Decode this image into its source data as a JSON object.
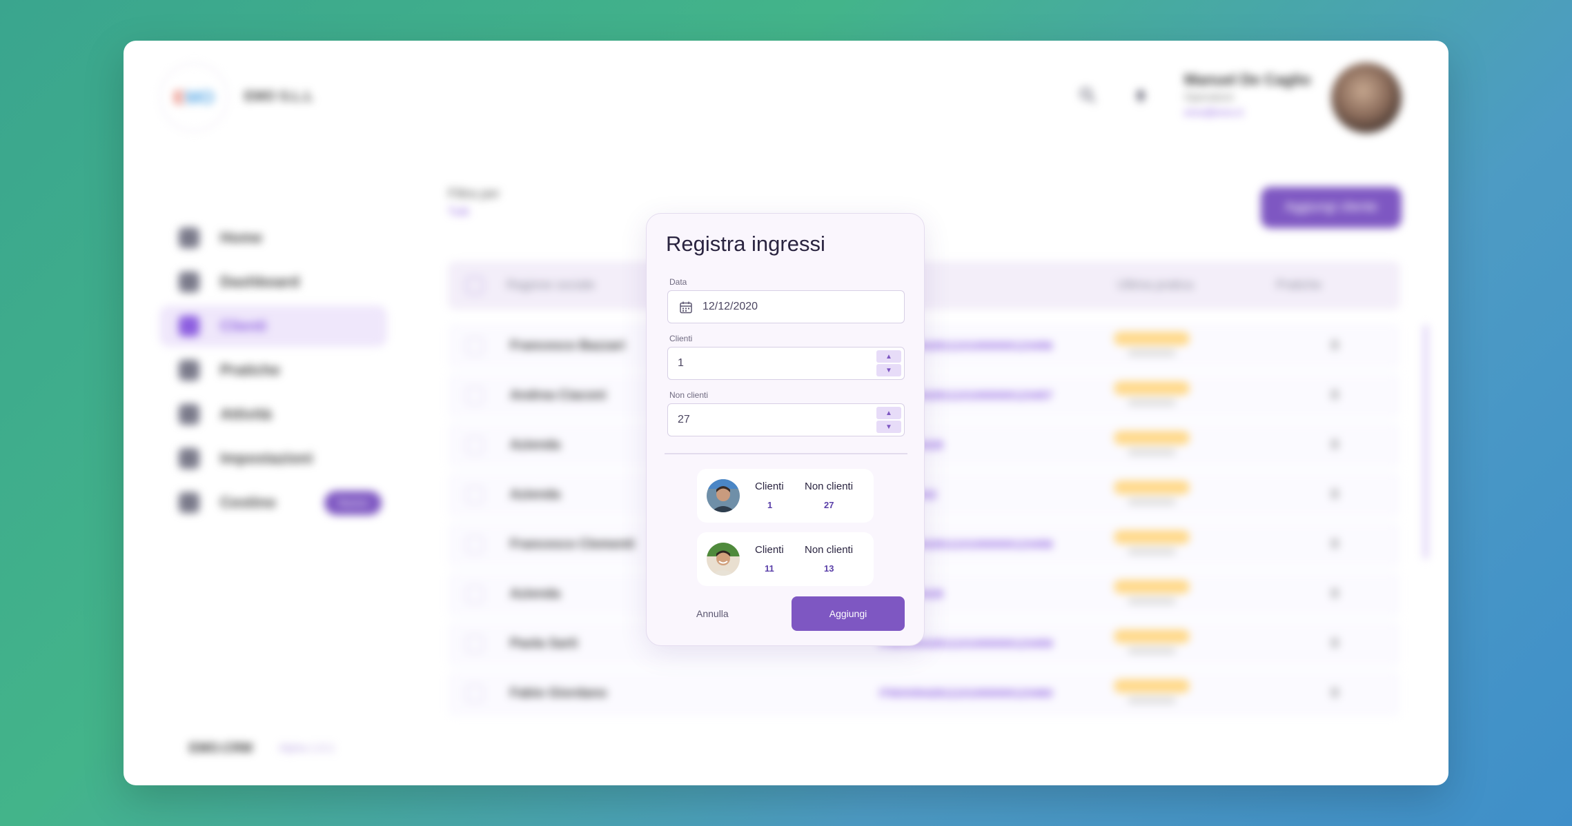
{
  "background_page": {
    "company_name": "EMO S.L.L",
    "user": {
      "name": "Manuel De Caglio",
      "role": "Operatore",
      "email": "emo@emo.it"
    },
    "sidebar": {
      "items": [
        {
          "label": "Home",
          "active": false
        },
        {
          "label": "Dashboard",
          "active": false
        },
        {
          "label": "Clienti",
          "active": true
        },
        {
          "label": "Pratiche",
          "active": false
        },
        {
          "label": "Attività",
          "active": false
        },
        {
          "label": "Impostazioni",
          "active": false
        },
        {
          "label": "Cestino",
          "active": false,
          "badge": "Nuovo"
        }
      ],
      "footer_brand": "EMO.CRM",
      "footer_version": "Alpha 1.0.1"
    },
    "filter": {
      "label": "Filtra per",
      "value": "Tutti"
    },
    "add_client_label": "Aggiungi cliente",
    "table": {
      "headers": [
        "Ragione sociale",
        "Ultima pratica",
        "Pratiche"
      ],
      "rows": [
        {
          "name": "Francesco Bazzari",
          "code": "IT60X0542811101000000123456",
          "count": "0"
        },
        {
          "name": "Andrea Ciaconi",
          "code": "IT60X0542811101000000123457",
          "count": "0"
        },
        {
          "name": "Azienda",
          "code": "IT60X05428",
          "count": "0"
        },
        {
          "name": "Azienda",
          "code": "IT60X0542",
          "count": "0"
        },
        {
          "name": "Francesco Clementi",
          "code": "IT60X0542811101000000123458",
          "count": "0"
        },
        {
          "name": "Azienda",
          "code": "IT60X05428",
          "count": "0"
        },
        {
          "name": "Paola Sarti",
          "code": "IT60X0542811101000000123459",
          "count": "0"
        },
        {
          "name": "Fabio Giordano",
          "code": "IT60X0542811101000000123460",
          "count": "0"
        }
      ]
    }
  },
  "modal": {
    "title": "Registra ingressi",
    "date": {
      "label": "Data",
      "value": "12/12/2020"
    },
    "clients": {
      "label": "Clienti",
      "value": "1"
    },
    "non_clients": {
      "label": "Non clienti",
      "value": "27"
    },
    "entries": [
      {
        "clients_label": "Clienti",
        "clients_value": "1",
        "non_clients_label": "Non clienti",
        "non_clients_value": "27"
      },
      {
        "clients_label": "Clienti",
        "clients_value": "11",
        "non_clients_label": "Non clienti",
        "non_clients_value": "13"
      }
    ],
    "cancel_label": "Annulla",
    "submit_label": "Aggiungi"
  },
  "colors": {
    "accent": "#7e57c2",
    "accent_light": "#e7dcf8",
    "modal_bg": "#faf6fd"
  }
}
